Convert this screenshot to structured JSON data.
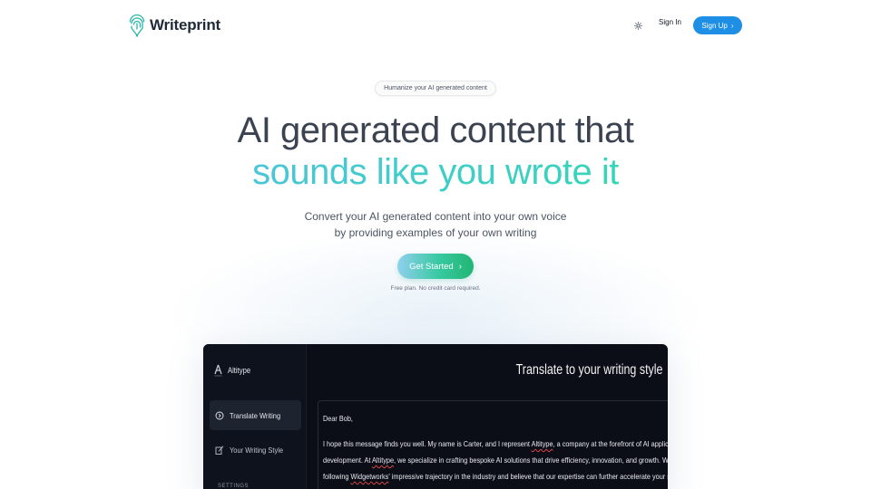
{
  "brand": {
    "name": "Writeprint",
    "accent": "#1f8fe6",
    "gradient_start": "#4ac6d8",
    "gradient_end": "#35d5b8"
  },
  "nav": {
    "theme_icon": "sun-icon",
    "signin_label": "Sign In",
    "signup_label": "Sign Up"
  },
  "hero": {
    "badge": "Humanize your AI generated content",
    "headline_line1": "AI generated content that",
    "headline_line2": "sounds like you wrote it",
    "subtitle_line1": "Convert your AI generated content into your own voice",
    "subtitle_line2": "by providing examples of your own writing",
    "cta_label": "Get Started",
    "cta_note": "Free plan. No credit card required."
  },
  "preview": {
    "app_name": "Altitype",
    "sidebar": {
      "items": [
        {
          "label": "Translate Writing",
          "icon": "circle-arrow-icon",
          "active": true
        },
        {
          "label": "Your Writing Style",
          "icon": "pen-note-icon",
          "active": false
        }
      ],
      "section_label": "SETTINGS"
    },
    "title": "Translate to your writing style",
    "doc": {
      "greeting": "Dear Bob,",
      "line1_a": "I hope this message finds you well. My name is Carter, and I represent ",
      "line1_company": "Altitype",
      "line1_b": ", a company at the forefront of AI application",
      "line2_a": "development. At ",
      "line2_company": "Altitype",
      "line2_b": ", we specialize in crafting bespoke AI solutions that drive efficiency, innovation, and growth. We have been",
      "line3_a": "following ",
      "line3_client": "Widgetworks",
      "line3_b": "' impressive trajectory in the industry and believe that our expertise can further accelerate your success by"
    }
  }
}
